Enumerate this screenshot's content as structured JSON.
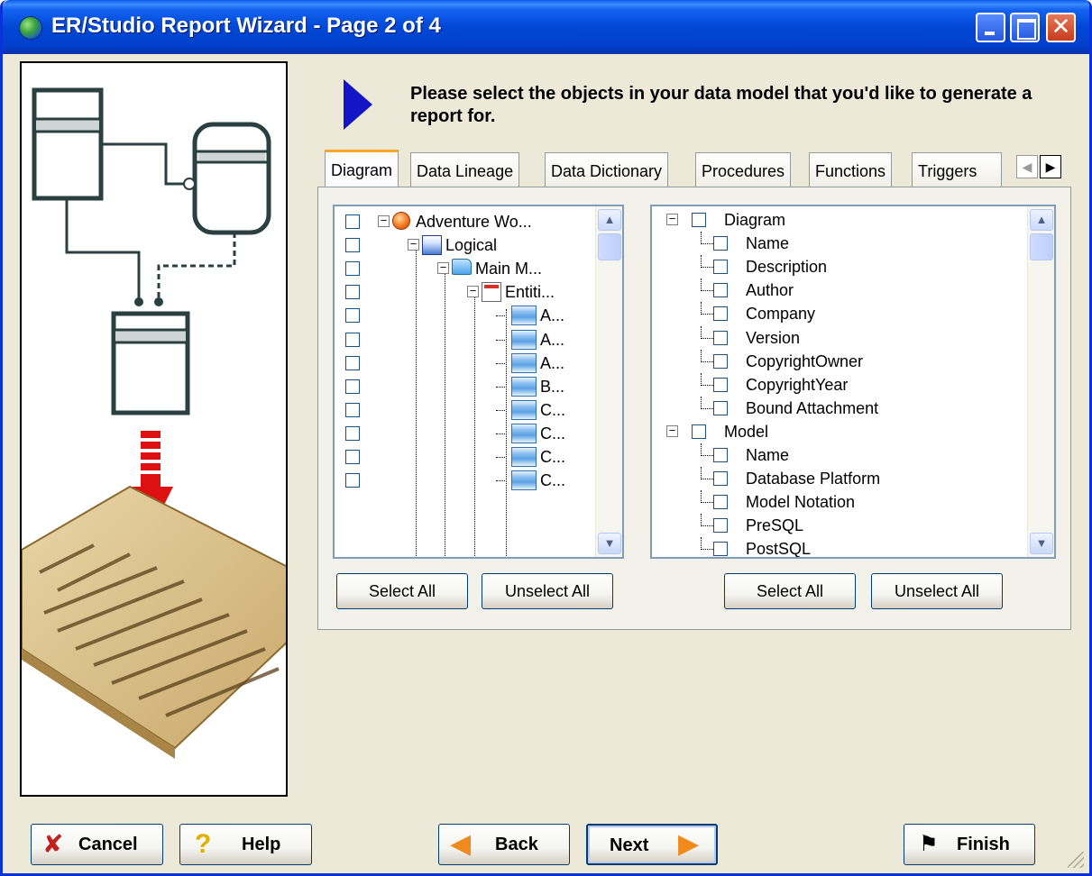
{
  "window": {
    "title": "ER/Studio Report Wizard - Page 2 of 4"
  },
  "instruction": "Please select the objects in your data model that you'd like to generate a report for.",
  "tabs": [
    {
      "label": "Diagram",
      "active": true
    },
    {
      "label": "Data Lineage",
      "active": false
    },
    {
      "label": "Data Dictionary",
      "active": false
    },
    {
      "label": "Procedures",
      "active": false
    },
    {
      "label": "Functions",
      "active": false
    },
    {
      "label": "Triggers",
      "active": false
    }
  ],
  "object_tree": {
    "items": [
      {
        "label": "Adventure Wo...",
        "icon": "project-icon",
        "level": 0
      },
      {
        "label": "Logical",
        "icon": "logical-model-icon",
        "level": 1
      },
      {
        "label": "Main M...",
        "icon": "folder-icon",
        "level": 2
      },
      {
        "label": "Entiti...",
        "icon": "entities-icon",
        "level": 3
      },
      {
        "label": "A...",
        "icon": "table-icon",
        "level": 4
      },
      {
        "label": "A...",
        "icon": "table-icon",
        "level": 4
      },
      {
        "label": "A...",
        "icon": "table-icon",
        "level": 4
      },
      {
        "label": "B...",
        "icon": "table-icon",
        "level": 4
      },
      {
        "label": "C...",
        "icon": "table-icon",
        "level": 4
      },
      {
        "label": "C...",
        "icon": "table-icon",
        "level": 4
      },
      {
        "label": "C...",
        "icon": "table-icon",
        "level": 4
      },
      {
        "label": "C...",
        "icon": "table-icon",
        "level": 4
      }
    ]
  },
  "property_tree": {
    "items": [
      {
        "label": "Diagram",
        "group": true
      },
      {
        "label": "Name",
        "group": false
      },
      {
        "label": "Description",
        "group": false
      },
      {
        "label": "Author",
        "group": false
      },
      {
        "label": "Company",
        "group": false
      },
      {
        "label": "Version",
        "group": false
      },
      {
        "label": "CopyrightOwner",
        "group": false
      },
      {
        "label": "CopyrightYear",
        "group": false
      },
      {
        "label": "Bound Attachment",
        "group": false
      },
      {
        "label": "Model",
        "group": true
      },
      {
        "label": "Name",
        "group": false
      },
      {
        "label": "Database Platform",
        "group": false
      },
      {
        "label": "Model Notation",
        "group": false
      },
      {
        "label": "PreSQL",
        "group": false
      },
      {
        "label": "PostSQL",
        "group": false
      }
    ]
  },
  "buttons": {
    "select_all": "Select All",
    "unselect_all": "Unselect All",
    "cancel": "Cancel",
    "help": "Help",
    "back": "Back",
    "next": "Next",
    "finish": "Finish"
  },
  "colors": {
    "titlebar": "#0047d6",
    "dialog_bg": "#ece9d8",
    "instruction_arrow": "#1515c8",
    "cancel_x": "#c0211c",
    "nav_arrow": "#f08a1c"
  }
}
